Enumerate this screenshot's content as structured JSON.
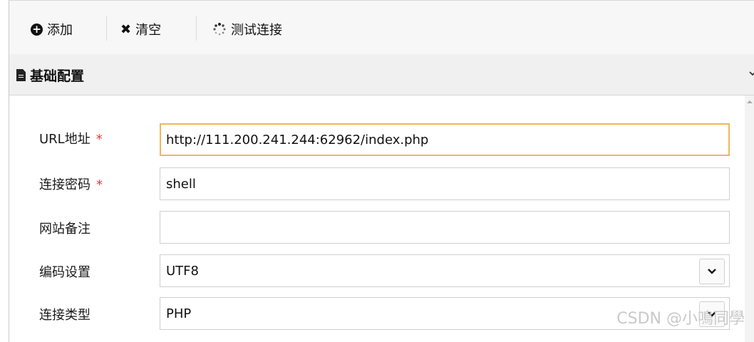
{
  "toolbar": {
    "add_label": "添加",
    "clear_label": "清空",
    "test_label": "测试连接"
  },
  "section": {
    "title": "基础配置"
  },
  "form": {
    "url_label": "URL地址",
    "url_value": "http://111.200.241.244:62962/index.php",
    "password_label": "连接密码",
    "password_value": "shell",
    "note_label": "网站备注",
    "note_value": "",
    "encoding_label": "编码设置",
    "encoding_value": "UTF8",
    "type_label": "连接类型",
    "type_value": "PHP",
    "required_mark": "*"
  },
  "watermark": "CSDN @小鳴同學",
  "colors": {
    "required": "#e53935",
    "focus_border": "#f0b75a"
  }
}
